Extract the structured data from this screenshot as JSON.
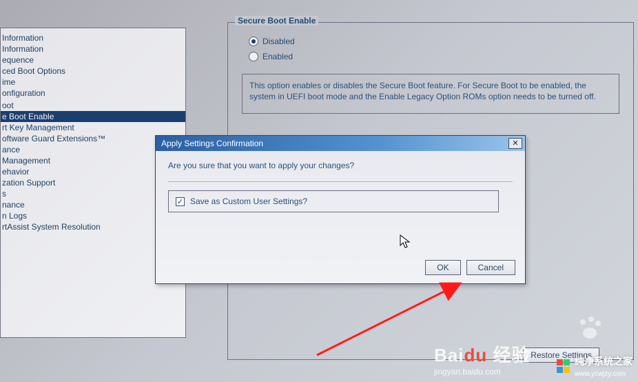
{
  "sidebar": {
    "items": [
      {
        "label": "Information",
        "selected": false
      },
      {
        "label": "Information",
        "selected": false
      },
      {
        "label": "equence",
        "selected": false
      },
      {
        "label": "ced Boot Options",
        "selected": false
      },
      {
        "label": "ime",
        "selected": false
      },
      {
        "label": "onfiguration",
        "selected": false
      },
      {
        "label": "",
        "selected": false
      },
      {
        "label": "oot",
        "selected": false
      },
      {
        "label": "e Boot Enable",
        "selected": true
      },
      {
        "label": "rt Key Management",
        "selected": false
      },
      {
        "label": "oftware Guard Extensions™",
        "selected": false
      },
      {
        "label": "ance",
        "selected": false
      },
      {
        "label": "Management",
        "selected": false
      },
      {
        "label": "ehavior",
        "selected": false
      },
      {
        "label": "zation Support",
        "selected": false
      },
      {
        "label": "s",
        "selected": false
      },
      {
        "label": "nance",
        "selected": false
      },
      {
        "label": "n Logs",
        "selected": false
      },
      {
        "label": "rtAssist System Resolution",
        "selected": false
      }
    ]
  },
  "main": {
    "legend": "Secure Boot Enable",
    "options": {
      "disabled_label": "Disabled",
      "enabled_label": "Enabled",
      "selected": "Disabled"
    },
    "description": "This option enables or disables the Secure Boot feature. For Secure Boot to be enabled, the system in UEFI boot mode and the Enable Legacy Option ROMs option needs to be turned off.",
    "restore_label": "Restore Settings"
  },
  "dialog": {
    "title": "Apply Settings Confirmation",
    "question": "Are you sure that you want to apply your changes?",
    "checkbox_label": "Save as Custom User Settings?",
    "checkbox_checked": true,
    "ok_label": "OK",
    "cancel_label": "Cancel",
    "close_glyph": "✕"
  },
  "watermarks": {
    "baidu_main": "Bai",
    "baidu_suffix": "经验",
    "baidu_sub": "jingyan.baidu.com",
    "right_main": "纯净系统之家",
    "right_sub": "www.ycwjzy.com",
    "logo_colors": [
      "#e74c3c",
      "#2ecc71",
      "#3498db",
      "#f1c40f"
    ]
  },
  "icons": {
    "checkmark": "✓",
    "cursor": "↖"
  }
}
